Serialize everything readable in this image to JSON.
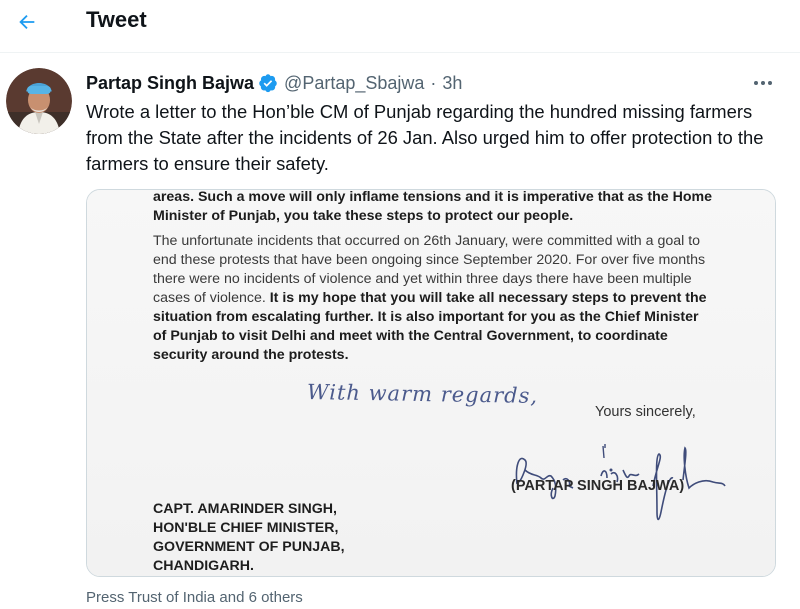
{
  "header": {
    "title": "Tweet"
  },
  "tweet": {
    "author_name": "Partap Singh Bajwa",
    "handle": "@Partap_Sbajwa",
    "separator": "·",
    "time": "3h",
    "text": "Wrote a letter to the Hon’ble CM of Punjab regarding the hundred missing farmers from the State after the incidents of 26 Jan. Also urged him to offer protection to the farmers to ensure their safety."
  },
  "letter": {
    "para1": "areas. Such a move will only inflame tensions and it is imperative that as the Home Minister of Punjab, you take these steps to protect our people.",
    "para2_regular": "The unfortunate incidents that occurred on 26th January, were committed with a goal to end these protests that have been ongoing since September 2020. For over five months there were no incidents of violence and yet within three days there have been multiple cases of violence.",
    "para2_bold": " It is my hope that you will take all necessary steps to prevent the situation from escalating further. It is also important for you as the Chief Minister of Punjab to visit Delhi and meet with the Central Government, to coordinate security around the protests.",
    "handwritten_regards": "With warm regards,",
    "closing": "Yours sincerely,",
    "signatory": "(PARTAP SINGH BAJWA)",
    "recipient": [
      "CAPT. AMARINDER SINGH,",
      "HON'BLE CHIEF MINISTER,",
      "GOVERNMENT OF PUNJAB,",
      "CHANDIGARH."
    ]
  },
  "footer": {
    "source": "Press Trust of India and 6 others"
  },
  "colors": {
    "accent": "#1d9bf0",
    "secondary_text": "#536471",
    "primary_text": "#0f1419",
    "border": "#cfd9de"
  },
  "icons": {
    "back": "back-arrow-icon",
    "verified": "verified-badge-icon",
    "more": "more-options-icon"
  }
}
